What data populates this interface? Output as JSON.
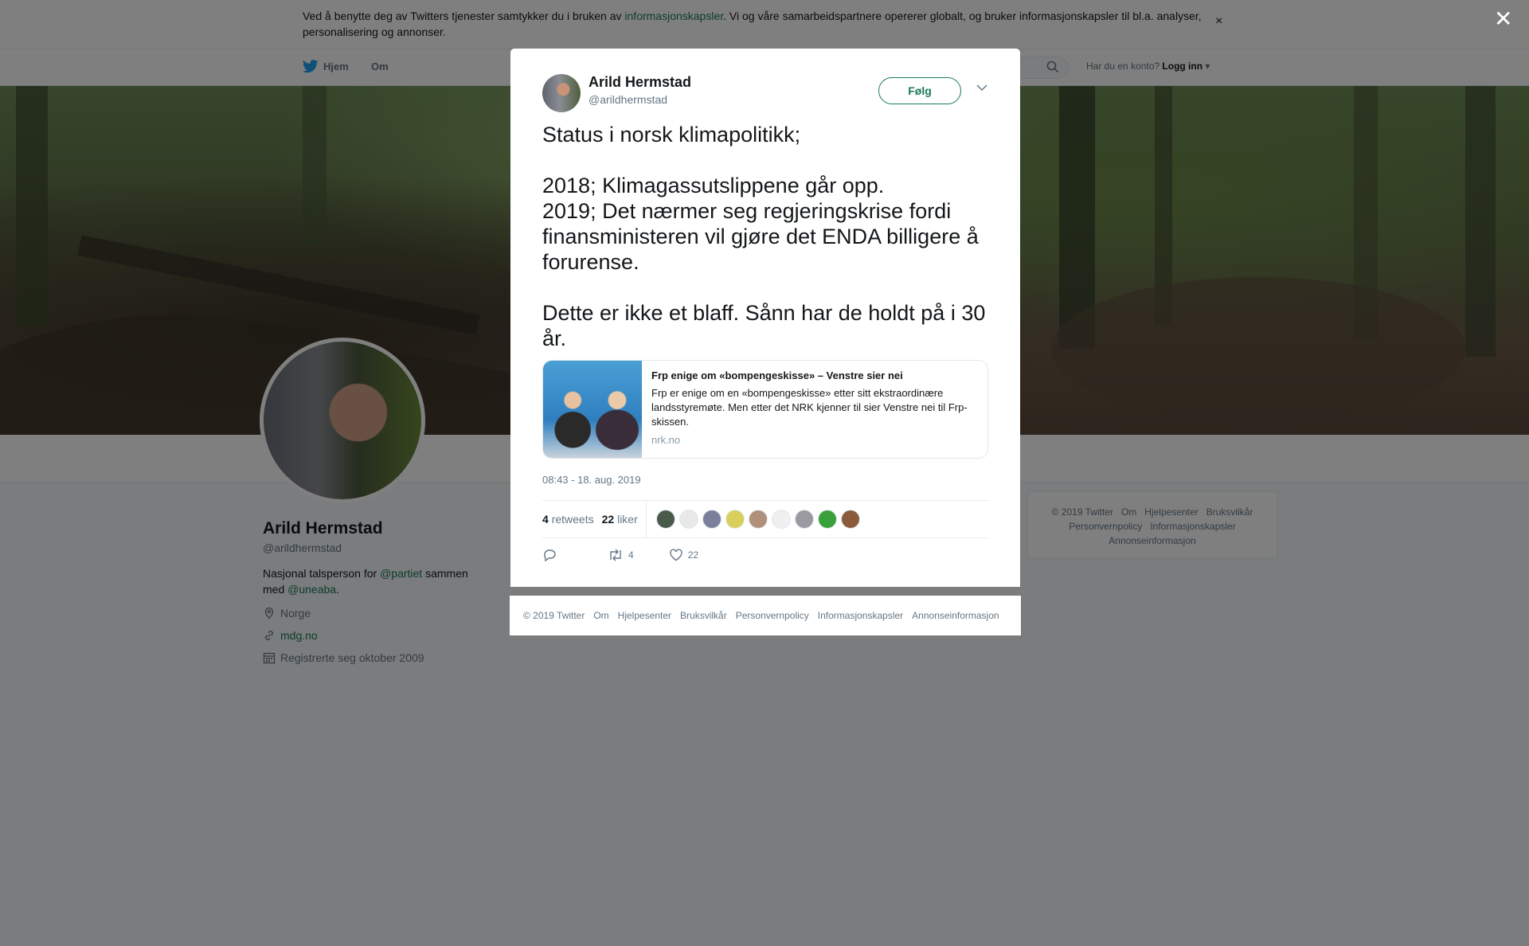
{
  "cookie": {
    "text_before": "Ved å benytte deg av Twitters tjenester samtykker du i bruken av ",
    "link": "informasjonskapsler",
    "text_after": ". Vi og våre samarbeidspartnere opererer globalt, og bruker informasjonskapsler til bl.a. analyser, personalisering og annonser.",
    "close": "×"
  },
  "nav": {
    "home": "Hjem",
    "about": "Om",
    "has_account": "Har du en konto?",
    "login": "Logg inn"
  },
  "profile": {
    "name": "Arild Hermstad",
    "handle": "@arildhermstad",
    "bio_before": "Nasjonal talsperson for ",
    "bio_link1": "@partiet",
    "bio_mid": " sammen med ",
    "bio_link2": "@uneaba",
    "bio_end": ".",
    "location": "Norge",
    "website": "mdg.no",
    "joined": "Registrerte seg oktober 2009"
  },
  "side_footer": {
    "items": [
      "© 2019 Twitter",
      "Om",
      "Hjelpesenter",
      "Bruksvilkår",
      "Personvernpolicy",
      "Informasjonskapsler",
      "Annonseinformasjon"
    ]
  },
  "overlay_close": "✕",
  "tweet": {
    "name": "Arild Hermstad",
    "handle": "@arildhermstad",
    "follow": "Følg",
    "text": "Status i norsk klimapolitikk;\n\n2018; Klimagassutslippene går opp.\n2019; Det nærmer seg regjeringskrise fordi finansministeren vil gjøre det ENDA billigere å forurense.\n\nDette er ikke et blaff. Sånn har de holdt på i 30 år.",
    "card": {
      "title": "Frp enige om «bompengeskisse» – Venstre sier nei",
      "description": "Frp er enige om en «bompengeskisse» etter sitt ekstraordinære landsstyremøte. Men etter det NRK kjenner til sier Venstre nei til Frp-skissen.",
      "domain": "nrk.no"
    },
    "time": "08:43 - 18. aug. 2019",
    "retweets_count": "4",
    "retweets_label": "retweets",
    "likes_count": "22",
    "likes_label": "liker",
    "action_retweets": "4",
    "action_likes": "22",
    "liker_colors": [
      "#4a5a4a",
      "#e8e8e8",
      "#7a7f9a",
      "#d8d05a",
      "#b0907a",
      "#f0f0f0",
      "#9a9aa0",
      "#3aa03a",
      "#8a5a3a"
    ]
  },
  "modal_footer": {
    "items": [
      "© 2019 Twitter",
      "Om",
      "Hjelpesenter",
      "Bruksvilkår",
      "Personvernpolicy",
      "Informasjonskapsler",
      "Annonseinformasjon"
    ]
  },
  "colors": {
    "accent": "#1b7a5a",
    "twitter_blue": "#1da1f2"
  }
}
